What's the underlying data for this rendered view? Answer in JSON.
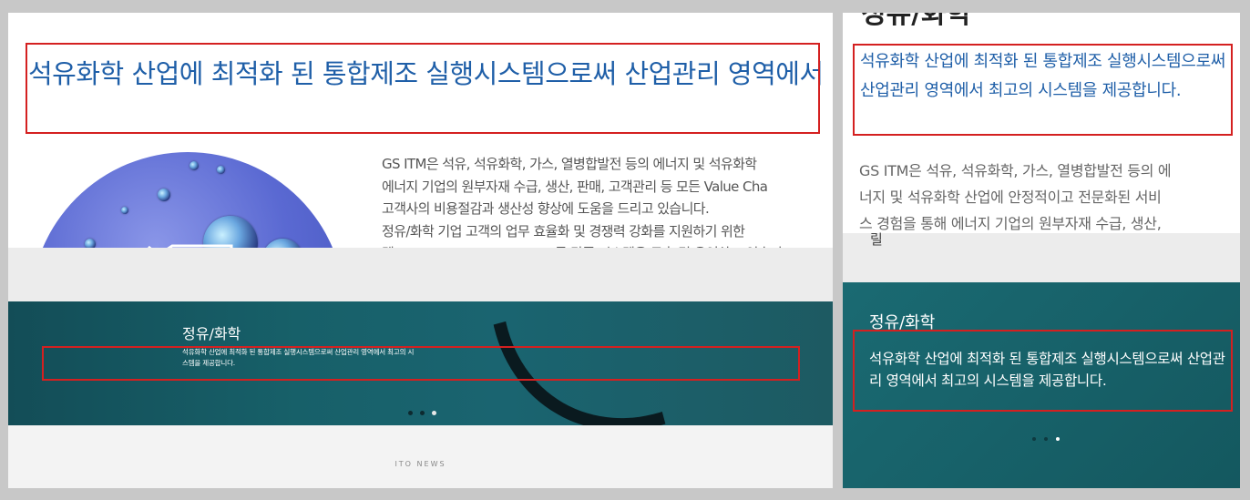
{
  "left": {
    "headline": "석유화학 산업에 최적화 된 통합제조 실행시스템으로써 산업관리 영역에서",
    "body_lines": [
      "GS ITM은 석유, 석유화학, 가스, 열병합발전 등의 에너지 및 석유화학",
      "에너지 기업의 원부자재 수급, 생산, 판매, 고객관리 등 모든 Value Cha",
      "고객사의 비용절감과 생산성 향상에 도움을 드리고 있습니다.",
      "정유/화학 기업 고객의 업무 효율화 및 경쟁력 강화를 지원하기 위한 ",
      "템, SCADA, SCM, ERP, CRM 등 각종 시스템을 구축 및 운영하고 있습니"
    ],
    "banner": {
      "title": "정유/화학",
      "description": "석유화학 산업에 최적화 된 통합제조 실행시스템으로써 산업관리 영역에서 최고의 시스템을 제공합니다."
    },
    "news_label": "ITO NEWS",
    "slider_active_index": 2
  },
  "right": {
    "cut_title": "정유/화학",
    "headline": "석유화학 산업에 최적화 된 통합제조 실행시스템으로써 산업관리 영역에서 최고의 시스템을 제공합니다.",
    "body_lines": [
      "GS ITM은 석유, 석유화학, 가스, 열병합발전 등의 에",
      "너지 및 석유화학 산업에 안정적이고 전문화된 서비",
      "스 경험을 통해 에너지 기업의 원부자재 수급, 생산,"
    ],
    "gray_glyph": "릴",
    "banner": {
      "title": "정유/화학",
      "description": "석유화학 산업에 최적화 된 통합제조 실행시스템으로써 산업관리 영역에서 최고의 시스템을 제공합니다."
    },
    "slider_active_index": 2
  },
  "colors": {
    "headline_blue": "#1f5fa8",
    "highlight_red": "#d42020",
    "banner_teal": "#176069"
  }
}
